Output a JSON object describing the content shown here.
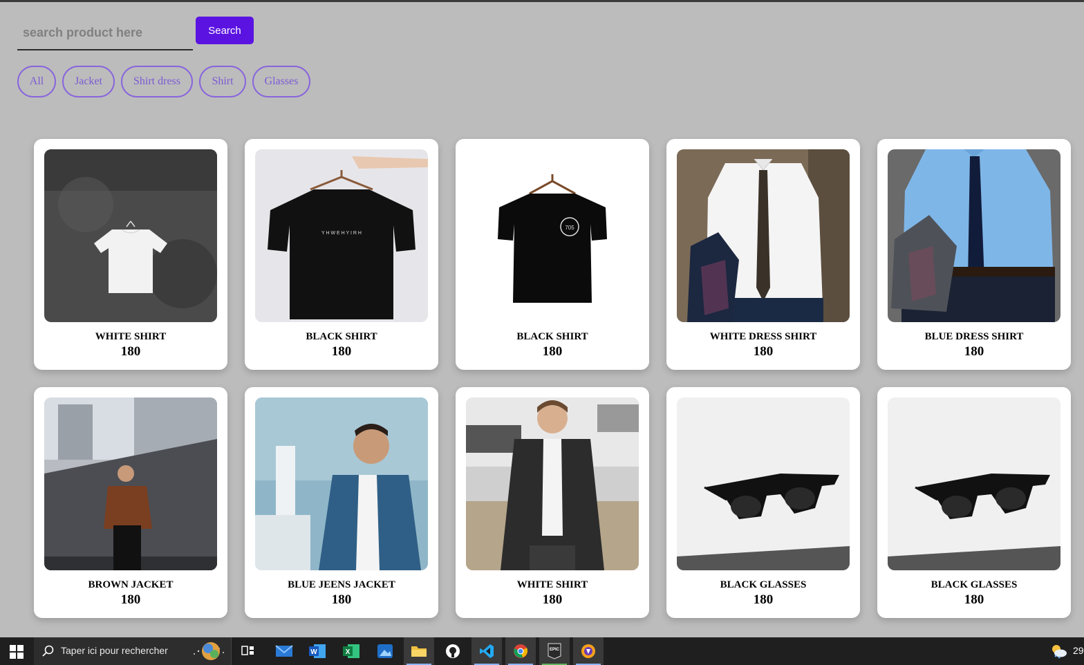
{
  "search": {
    "placeholder": "search product here",
    "button_label": "Search"
  },
  "filters": [
    "All",
    "Jacket",
    "Shirt dress",
    "Shirt",
    "Glasses"
  ],
  "products": [
    {
      "name": "WHITE SHIRT",
      "price": "180",
      "image": "white-tshirt-on-concrete-wall"
    },
    {
      "name": "BLACK SHIRT",
      "price": "180",
      "image": "black-tshirt-on-hanger"
    },
    {
      "name": "BLACK SHIRT",
      "price": "180",
      "image": "black-tshirt-white-background"
    },
    {
      "name": "WHITE DRESS SHIRT",
      "price": "180",
      "image": "man-white-dress-shirt-tie"
    },
    {
      "name": "BLUE DRESS SHIRT",
      "price": "180",
      "image": "man-blue-dress-shirt-tie"
    },
    {
      "name": "BROWN JACKET",
      "price": "180",
      "image": "man-brown-jacket-street"
    },
    {
      "name": "BLUE JEENS JACKET",
      "price": "180",
      "image": "man-denim-jacket"
    },
    {
      "name": "WHITE SHIRT",
      "price": "180",
      "image": "man-black-puffer-jacket"
    },
    {
      "name": "BLACK GLASSES",
      "price": "180",
      "image": "black-sunglasses"
    },
    {
      "name": "BLACK GLASSES",
      "price": "180",
      "image": "black-sunglasses"
    }
  ],
  "taskbar": {
    "search_placeholder": "Taper ici pour rechercher",
    "apps": [
      "task-view",
      "mail",
      "word",
      "excel",
      "photos",
      "file-explorer",
      "github",
      "vscode",
      "chrome",
      "epic-games",
      "brave"
    ],
    "tray_text": "29"
  },
  "colors": {
    "accent": "#5a13e0",
    "filter_border": "#8864dd",
    "background": "#bcbcbc"
  }
}
